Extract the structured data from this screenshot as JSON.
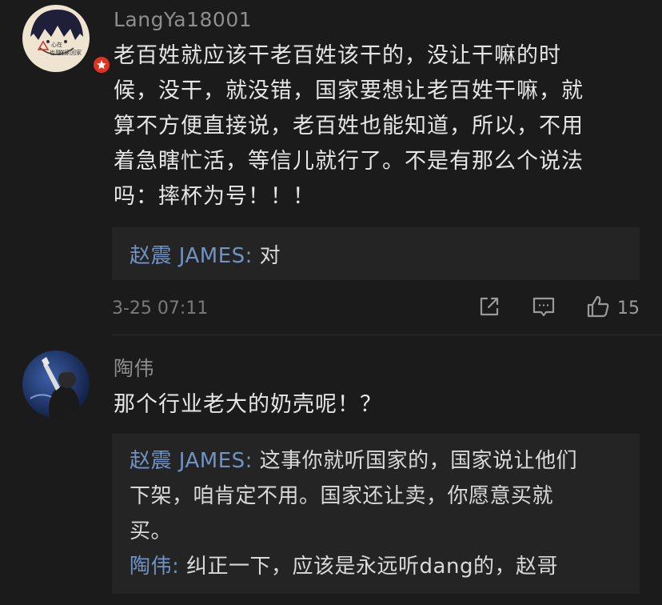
{
  "comments": [
    {
      "username": "LangYa18001",
      "text": "老百姓就应该干老百姓该干的，没让干嘛的时候，没干，就没错，国家要想让老百姓干嘛，就算不方便直接说，老百姓也能知道，所以，不用着急瞎忙活，等信儿就行了。不是有那么个说法吗：摔杯为号！！！",
      "lines": [
        "老百姓就应该干老百姓该干的，没让干嘛的时",
        "候，没干，就没错，国家要想让老百姓干嘛，就",
        "算不方便直接说，老百姓也能知道，所以，不用",
        "着急瞎忙活，等信儿就行了。不是有那么个说法",
        "吗：摔杯为号！！！"
      ],
      "avatar_text": [
        "心在",
        "也是心",
        "在家回家"
      ],
      "replies": [
        {
          "author": "赵震 JAMES:",
          "text": " 对"
        }
      ],
      "timestamp": "3-25 07:11",
      "like_count": "15",
      "icons": {
        "share": "share-icon",
        "reply": "comment-icon",
        "like": "thumbs-up-icon",
        "badge": "star-badge-icon"
      }
    },
    {
      "username": "陶伟",
      "text": "那个行业老大的奶壳呢！？",
      "replies": [
        {
          "author": "赵震 JAMES:",
          "lines": [
            " 这事你就听国家的，国家说让他们",
            "下架，咱肯定不用。国家还让卖，你愿意买就",
            "买。"
          ]
        },
        {
          "author": "陶伟:",
          "text": " 纠正一下，应该是永远听dang的，赵哥"
        }
      ]
    }
  ],
  "colors": {
    "background": "#1b1b1b",
    "reply_background": "#242424",
    "author_link": "#6f93c4",
    "badge": "#e0321f"
  }
}
